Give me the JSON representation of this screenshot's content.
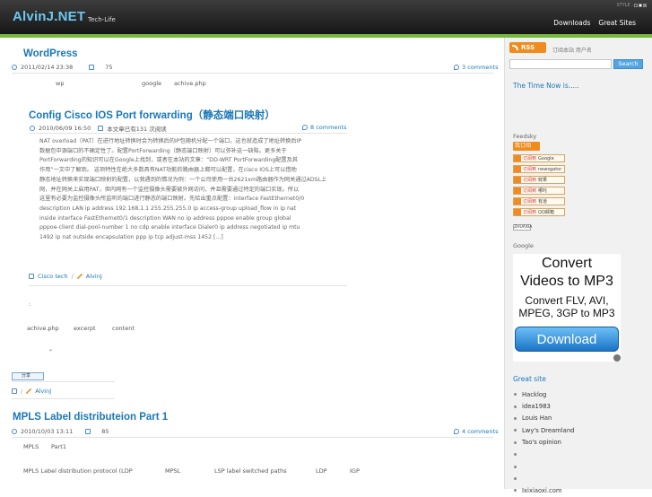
{
  "header": {
    "logo": "AlvinJ.NET",
    "tagline": "Tech-Life",
    "style_label": "STYLE :",
    "nav": [
      "Downloads",
      "Great Sites"
    ]
  },
  "colors": {
    "accent": "#1a78b8",
    "green_bar": "#74b83c",
    "rss": "#f08c1e",
    "logo": "#6cc8f0"
  },
  "posts": [
    {
      "title": "WordPress",
      "date": "2011/02/14 23:38",
      "views": "75",
      "comments": "3 comments",
      "excerpt_words": [
        "wp",
        "google",
        "achive.php"
      ]
    },
    {
      "title": "Config Cisco IOS Port forwarding（静态端口映射）",
      "date": "2010/06/09 16:50",
      "views": "本文章已有131 次阅读",
      "comments": "8 comments",
      "body": [
        "NAT overload（PAT）在进行地址转换时会为转换后的IP包随机分配一个端口，这也就造成了地址转换后IP",
        "数据包中源端口的不确定性了。配置PortForwarding（静态端口映射）可以弥补这一缺陷。更多关于",
        "PortForwarding的知识可以在Google上找到，或者在本站的文章：“DD-WRT PortForwarding配置及其",
        "作用”一文中了解到。 这项特性在绝大多数具有NAT功能的路由器上都可以配置，在cisco IOS上可以借助",
        "静态地址转换来实现端口映射的配置，以我遇到的情况为例：一个公司使用一台2621xm路由器作为网关通过ADSL上",
        "网，并在网关上启用PAT，但内网有一个监控摄像头需要被外网访问，并且需要通过特定的端口实现。所以",
        "这里有必要为监控摄像头所监听的端口进行静态的端口映射。先给出重点配置：interface FastEthernet0/0",
        "description LAN ip address 192.168.1.1 255.255.255.0 ip access-group upload_flow in ip nat",
        "inside interface FastEthernet0/1 description WAN no ip address pppoe enable group global",
        "pppoe-client dial-pool-number 1 no cdp enable interface Dialer0 ip address negotiated ip mtu",
        "1492 ip nat outside encapsulation ppp ip tcp adjust-mss 1452 [...]"
      ],
      "category": "Cisco tech",
      "author": "AlvinJ"
    },
    {
      "colon": ":",
      "words": [
        "achive.php",
        "excerpt",
        "content"
      ],
      "quote": "\"",
      "share_label": "分享",
      "author": "AlvinJ"
    },
    {
      "title": "MPLS Label distributeion Part 1",
      "date": "2010/10/03 13:11",
      "views": "85",
      "comments": "4 comments",
      "line1": [
        "MPLS",
        "Part1"
      ],
      "line2": [
        "MPLS Label distribution protocol (LDP",
        "MPSL",
        "LSP label switched paths",
        "LDP",
        "IGP"
      ]
    }
  ],
  "sidebar": {
    "rss_label": "RSS",
    "feed_note": "订阅本站 用户名",
    "search_placeholder": "",
    "search_button": "Search",
    "time_heading": "The Time Now is.....",
    "feedsky": "Feedsky",
    "subscribe_tag": "我订阅",
    "feed_buttons": [
      {
        "prefix": "订阅到",
        "name": "Google"
      },
      {
        "prefix": "订阅到",
        "name": "newsgator"
      },
      {
        "prefix": "订阅到",
        "name": "鲜果"
      },
      {
        "prefix": "订阅到",
        "name": "哪吒"
      },
      {
        "prefix": "订阅到",
        "name": "有道"
      },
      {
        "prefix": "订阅到",
        "name": "QQ邮箱"
      }
    ],
    "zhuaxia": "ZHUAXIA",
    "google_label": "Google",
    "ad": {
      "line1": "Convert",
      "line2": "Videos to MP3",
      "line3": "Convert FLV, AVI,",
      "line4": "MPEG, 3GP to MP3",
      "button": "Download"
    },
    "great_site_heading": "Great site",
    "sites": [
      "Hacklog",
      "idea1983",
      "Louis Han",
      "Lwy's Dreamland",
      "Tao's opinion",
      "",
      "",
      "",
      "Ixixiaoxi.com"
    ]
  }
}
